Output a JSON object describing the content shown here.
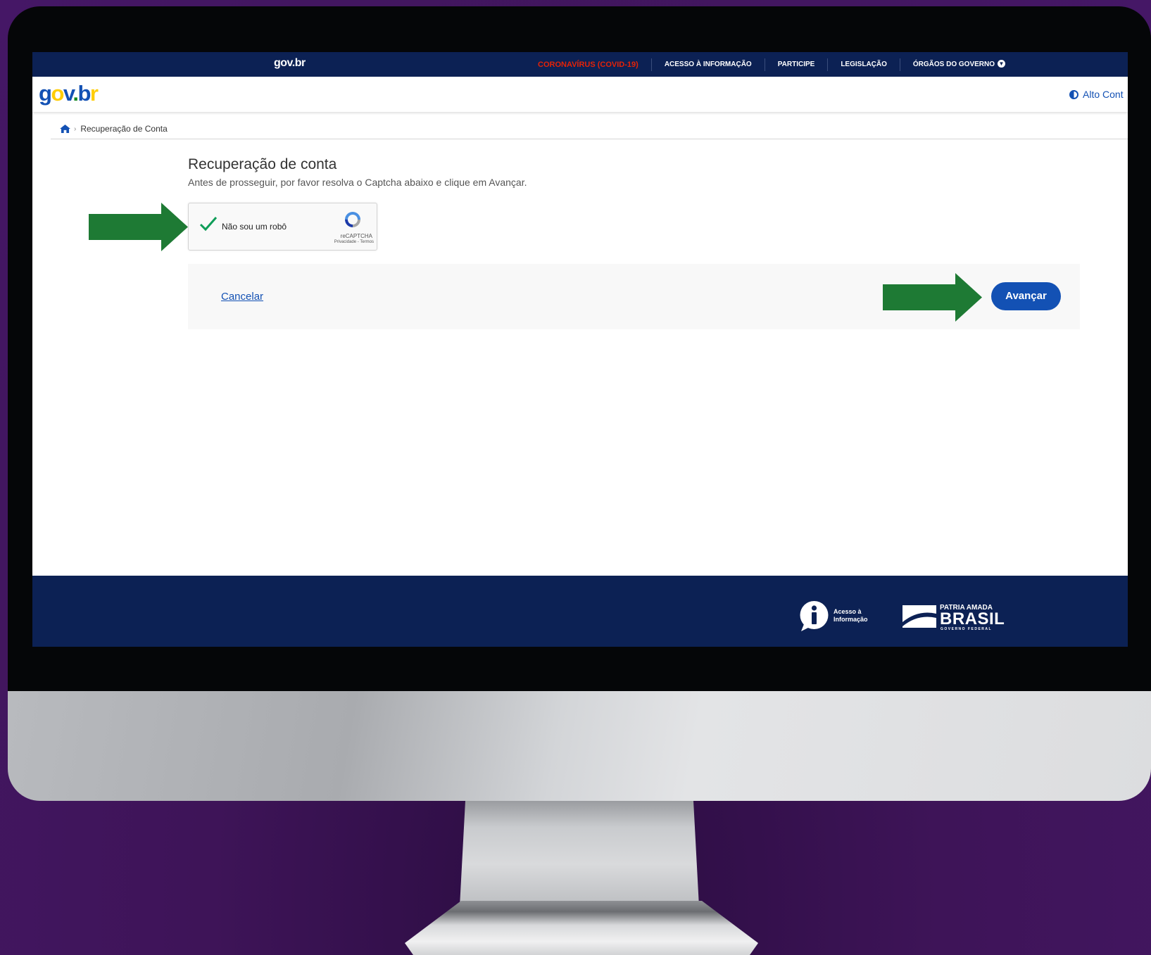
{
  "topbar": {
    "logo": "gov.br",
    "nav": [
      {
        "label": "CORONAVÍRUS (COVID-19)",
        "highlight": true
      },
      {
        "label": "ACESSO À INFORMAÇÃO"
      },
      {
        "label": "PARTICIPE"
      },
      {
        "label": "LEGISLAÇÃO"
      },
      {
        "label": "ÓRGÃOS DO GOVERNO"
      }
    ]
  },
  "header": {
    "logo_parts": [
      "g",
      "o",
      "v",
      ".",
      "b",
      "r"
    ],
    "contrast_label": "Alto Cont"
  },
  "breadcrumb": {
    "current": "Recuperação de Conta"
  },
  "main": {
    "title": "Recuperação de conta",
    "subtitle": "Antes de prosseguir, por favor resolva o Captcha abaixo e clique em Avançar."
  },
  "captcha": {
    "label": "Não sou um robô",
    "brand": "reCAPTCHA",
    "links": "Privacidade - Termos",
    "checked": true
  },
  "actions": {
    "cancel_label": "Cancelar",
    "next_label": "Avançar"
  },
  "footer": {
    "access_info": [
      "Acesso à",
      "Informação"
    ],
    "patria_top": "PATRIA AMADA",
    "patria_main": "BRASIL",
    "patria_sub": "GOVERNO FEDERAL"
  },
  "colors": {
    "primary": "#1351b4",
    "topbar": "#0c2154",
    "annotation_arrow": "#1e7a34",
    "alert": "#e52207",
    "background": "#3e1458"
  }
}
